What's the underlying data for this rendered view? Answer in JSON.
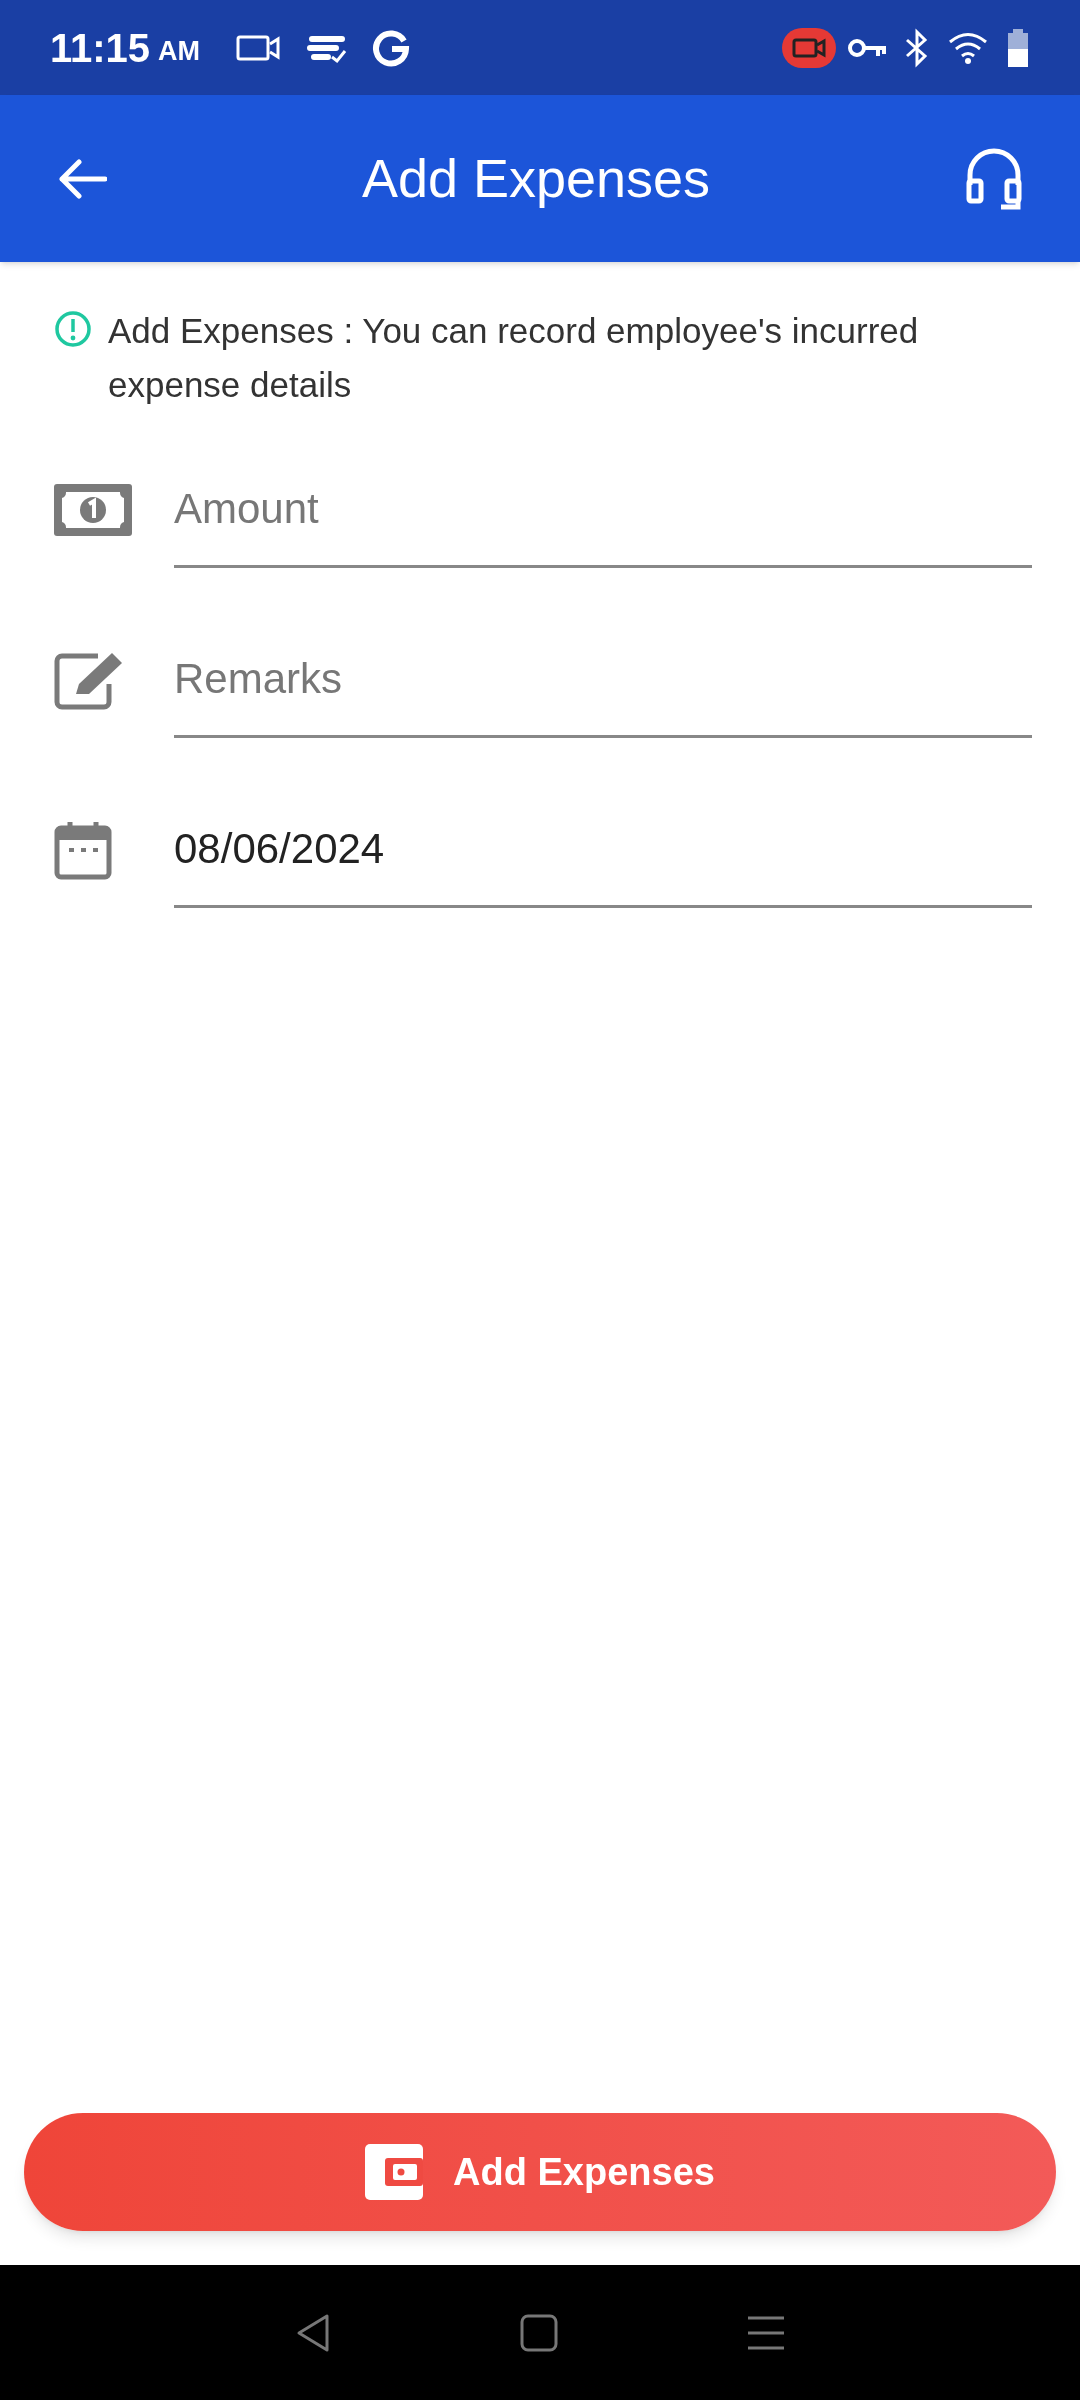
{
  "status_bar": {
    "time": "11:15",
    "meridiem": "AM"
  },
  "header": {
    "title": "Add Expenses"
  },
  "info": {
    "text": "Add Expenses : You can record employee's incurred expense details"
  },
  "fields": [
    {
      "kind": "amount",
      "placeholder": "Amount"
    },
    {
      "kind": "remarks",
      "placeholder": "Remarks"
    },
    {
      "kind": "date",
      "value": "08/06/2024"
    }
  ],
  "submit_button": {
    "label": "Add Expenses"
  }
}
